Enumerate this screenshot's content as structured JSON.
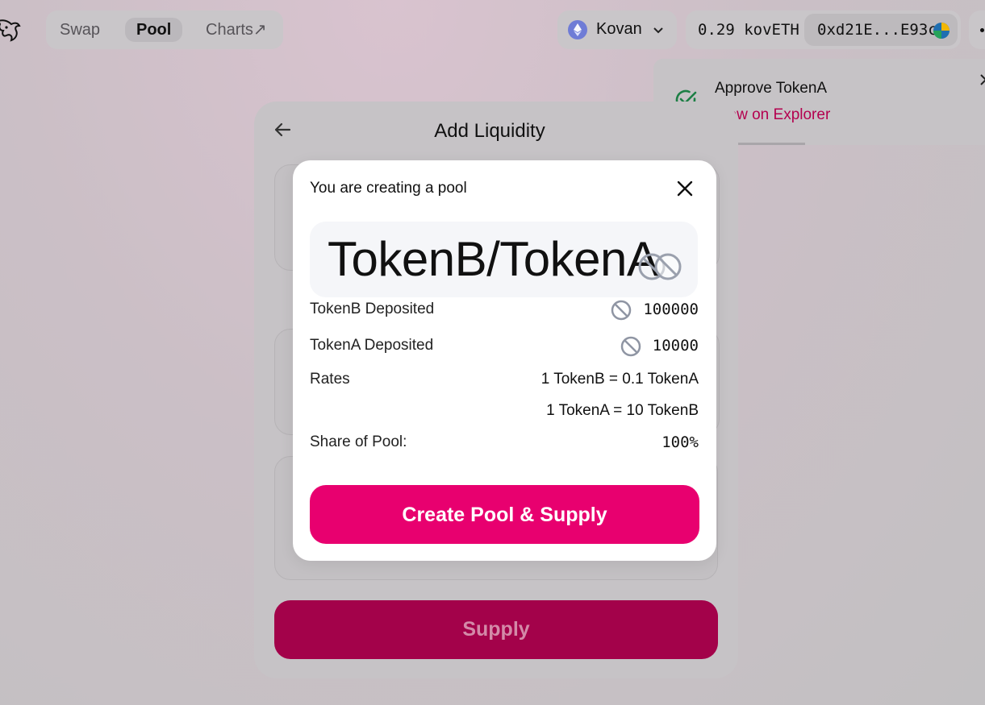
{
  "nav": {
    "swap": "Swap",
    "pool": "Pool",
    "charts": "Charts↗"
  },
  "network": {
    "name": "Kovan"
  },
  "wallet": {
    "balance": "0.29 kovETH",
    "address": "0xd21E...E93c"
  },
  "toast": {
    "title": "Approve TokenA",
    "link": "View on Explorer"
  },
  "card": {
    "title": "Add Liquidity",
    "supply_label": "Supply"
  },
  "modal": {
    "heading": "You are creating a pool",
    "pair": "TokenB/TokenA",
    "tokenb_label": "TokenB Deposited",
    "tokenb_amount": "100000",
    "tokena_label": "TokenA Deposited",
    "tokena_amount": "10000",
    "rates_label": "Rates",
    "rate1": "1 TokenB = 0.1 TokenA",
    "rate2": "1 TokenA = 10 TokenB",
    "share_label": "Share of Pool:",
    "share_value": "100%",
    "create_label": "Create Pool & Supply"
  },
  "colors": {
    "accent": "#e8006f",
    "link": "#b4014f",
    "success": "#27ae60",
    "supply_disabled": "#a3024a"
  },
  "icons": [
    "unicorn-logo-icon",
    "ethereum-icon",
    "chevron-down-icon",
    "wallet-avatar-icon",
    "more-icon",
    "check-circle-icon",
    "toast-close-icon",
    "back-arrow-icon",
    "close-icon",
    "token-placeholder-icon"
  ]
}
